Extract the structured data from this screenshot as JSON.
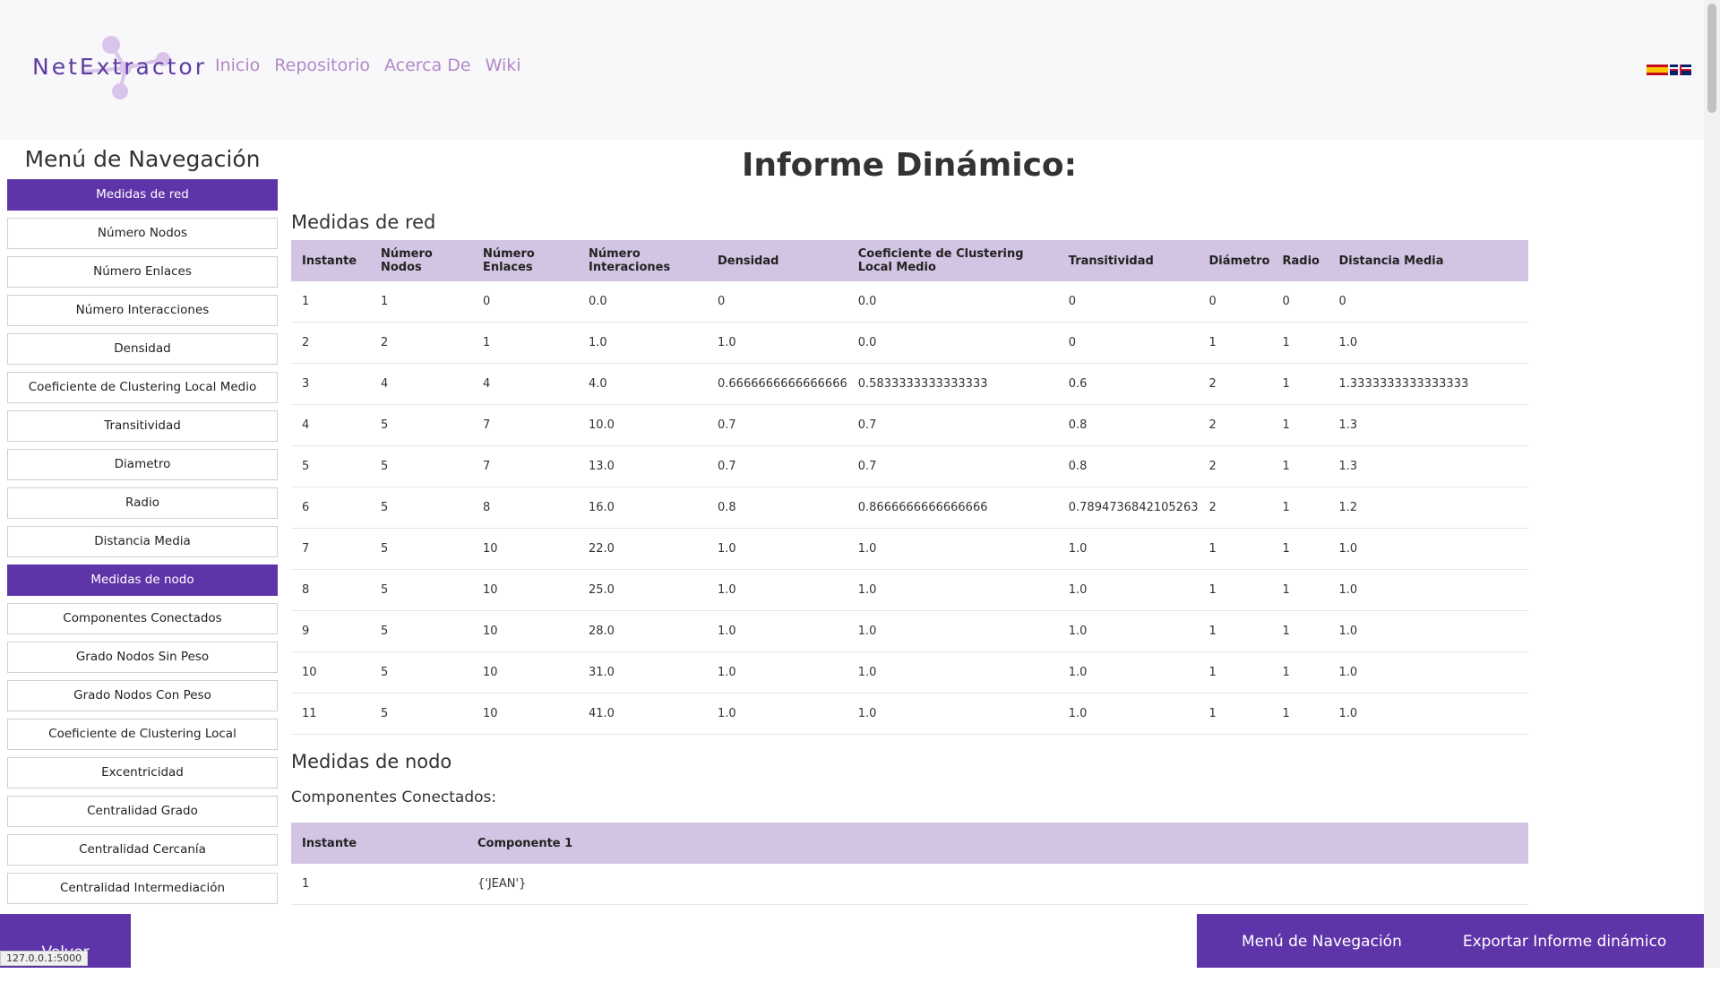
{
  "header": {
    "logo_text": "NetExtractor",
    "nav": [
      "Inicio",
      "Repositorio",
      "Acerca De",
      "Wiki"
    ]
  },
  "sidebar": {
    "title": "Menú de Navegación",
    "items": [
      {
        "label": "Medidas de red",
        "type": "head"
      },
      {
        "label": "Número Nodos",
        "type": "item"
      },
      {
        "label": "Número Enlaces",
        "type": "item"
      },
      {
        "label": "Número Interacciones",
        "type": "item"
      },
      {
        "label": "Densidad",
        "type": "item"
      },
      {
        "label": "Coeficiente de Clustering Local Medio",
        "type": "item"
      },
      {
        "label": "Transitividad",
        "type": "item"
      },
      {
        "label": "Diametro",
        "type": "item"
      },
      {
        "label": "Radio",
        "type": "item"
      },
      {
        "label": "Distancia Media",
        "type": "item"
      },
      {
        "label": "Medidas de nodo",
        "type": "head"
      },
      {
        "label": "Componentes Conectados",
        "type": "item"
      },
      {
        "label": "Grado Nodos Sin Peso",
        "type": "item"
      },
      {
        "label": "Grado Nodos Con Peso",
        "type": "item"
      },
      {
        "label": "Coeficiente de Clustering Local",
        "type": "item"
      },
      {
        "label": "Excentricidad",
        "type": "item"
      },
      {
        "label": "Centralidad Grado",
        "type": "item"
      },
      {
        "label": "Centralidad Cercanía",
        "type": "item"
      },
      {
        "label": "Centralidad Intermediación",
        "type": "item"
      }
    ]
  },
  "main": {
    "title": "Informe Dinámico:",
    "network_section": "Medidas de red",
    "network_table": {
      "headers": [
        "Instante",
        "Número Nodos",
        "Número Enlaces",
        "Número Interaciones",
        "Densidad",
        "Coeficiente de Clustering Local Medio",
        "Transitividad",
        "Diámetro",
        "Radio",
        "Distancia Media"
      ],
      "rows": [
        [
          "1",
          "1",
          "0",
          "0.0",
          "0",
          "0.0",
          "0",
          "0",
          "0",
          "0"
        ],
        [
          "2",
          "2",
          "1",
          "1.0",
          "1.0",
          "0.0",
          "0",
          "1",
          "1",
          "1.0"
        ],
        [
          "3",
          "4",
          "4",
          "4.0",
          "0.6666666666666666",
          "0.5833333333333333",
          "0.6",
          "2",
          "1",
          "1.3333333333333333"
        ],
        [
          "4",
          "5",
          "7",
          "10.0",
          "0.7",
          "0.7",
          "0.8",
          "2",
          "1",
          "1.3"
        ],
        [
          "5",
          "5",
          "7",
          "13.0",
          "0.7",
          "0.7",
          "0.8",
          "2",
          "1",
          "1.3"
        ],
        [
          "6",
          "5",
          "8",
          "16.0",
          "0.8",
          "0.8666666666666666",
          "0.7894736842105263",
          "2",
          "1",
          "1.2"
        ],
        [
          "7",
          "5",
          "10",
          "22.0",
          "1.0",
          "1.0",
          "1.0",
          "1",
          "1",
          "1.0"
        ],
        [
          "8",
          "5",
          "10",
          "25.0",
          "1.0",
          "1.0",
          "1.0",
          "1",
          "1",
          "1.0"
        ],
        [
          "9",
          "5",
          "10",
          "28.0",
          "1.0",
          "1.0",
          "1.0",
          "1",
          "1",
          "1.0"
        ],
        [
          "10",
          "5",
          "10",
          "31.0",
          "1.0",
          "1.0",
          "1.0",
          "1",
          "1",
          "1.0"
        ],
        [
          "11",
          "5",
          "10",
          "41.0",
          "1.0",
          "1.0",
          "1.0",
          "1",
          "1",
          "1.0"
        ]
      ]
    },
    "node_section": "Medidas de nodo",
    "components_title": "Componentes Conectados:",
    "components_table": {
      "headers": [
        "Instante",
        "Componente 1"
      ],
      "rows": [
        [
          "1",
          "{'JEAN'}"
        ]
      ]
    }
  },
  "bottom": {
    "back_label": "Volver",
    "nav_menu_label": "Menú de Navegación",
    "export_label": "Exportar Informe dinámico"
  },
  "status_url": "127.0.0.1:5000",
  "colors": {
    "accent": "#5e35a8",
    "table_header": "#d3c4e3",
    "nav_link": "#b288c7"
  }
}
